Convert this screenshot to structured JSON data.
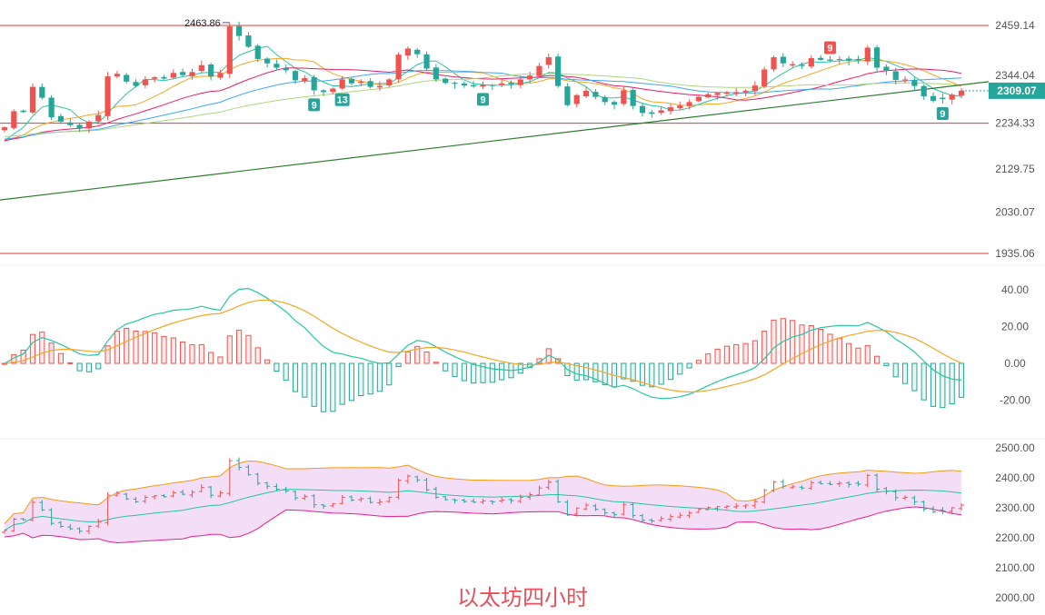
{
  "caption": "以太坊四小时",
  "colors": {
    "up": "#ef5350",
    "down": "#26a69a",
    "hline": "#e53935",
    "trendline": "#2e7d32",
    "ma1": "#26c6a0",
    "ma2": "#f5a623",
    "ma3": "#e91e63",
    "ma4": "#42a5f5",
    "ma5": "#aed581",
    "macd_dif": "#26c6a0",
    "macd_dea": "#f5a623",
    "boll_upper": "#f39c12",
    "boll_mid": "#26c6a0",
    "boll_lower": "#e91e8a",
    "boll_fill": "#f3ddf7",
    "price_tag": "#26a69a"
  },
  "chart_data": [
    {
      "type": "candlestick",
      "panel": "price",
      "y_ticks": [
        "2459.14",
        "2344.04",
        "2234.33",
        "2129.75",
        "2030.07",
        "1935.06"
      ],
      "ylim": [
        1935.06,
        2459.14
      ],
      "current_price": "2309.07",
      "high_label": "2463.86",
      "horizontal_levels": [
        2459.14,
        2234.33,
        1935.06
      ],
      "trendline": {
        "from": 2058,
        "to": 2330
      },
      "td_markers": [
        {
          "label": "9",
          "kind": "down"
        },
        {
          "label": "13",
          "kind": "down"
        },
        {
          "label": "9",
          "kind": "down"
        },
        {
          "label": "9",
          "kind": "up"
        },
        {
          "label": "9",
          "kind": "down"
        }
      ],
      "closes": [
        2225,
        2262,
        2260,
        2318,
        2293,
        2248,
        2238,
        2230,
        2222,
        2238,
        2253,
        2342,
        2348,
        2330,
        2320,
        2335,
        2340,
        2337,
        2350,
        2345,
        2352,
        2368,
        2342,
        2350,
        2457,
        2435,
        2410,
        2382,
        2372,
        2362,
        2356,
        2333,
        2338,
        2310,
        2306,
        2314,
        2335,
        2326,
        2330,
        2318,
        2320,
        2335,
        2392,
        2406,
        2393,
        2360,
        2335,
        2327,
        2325,
        2321,
        2319,
        2323,
        2320,
        2326,
        2324,
        2335,
        2344,
        2366,
        2386,
        2320,
        2276,
        2299,
        2309,
        2295,
        2283,
        2277,
        2310,
        2274,
        2258,
        2256,
        2264,
        2271,
        2275,
        2283,
        2295,
        2301,
        2304,
        2305,
        2306,
        2309,
        2321,
        2358,
        2386,
        2372,
        2370,
        2366,
        2384,
        2380,
        2378,
        2382,
        2378,
        2379,
        2408,
        2362,
        2355,
        2334,
        2335,
        2320,
        2296,
        2286,
        2290,
        2300,
        2309
      ],
      "macd": {
        "y_ticks": [
          "40.00",
          "20.00",
          "0.00",
          "-20.00"
        ],
        "ylim": [
          -30,
          45
        ]
      },
      "bollinger": {
        "y_ticks": [
          "2500.00",
          "2400.00",
          "2300.00",
          "2200.00",
          "2100.00",
          "2000.00"
        ],
        "ylim": [
          1990,
          2510
        ]
      }
    }
  ]
}
